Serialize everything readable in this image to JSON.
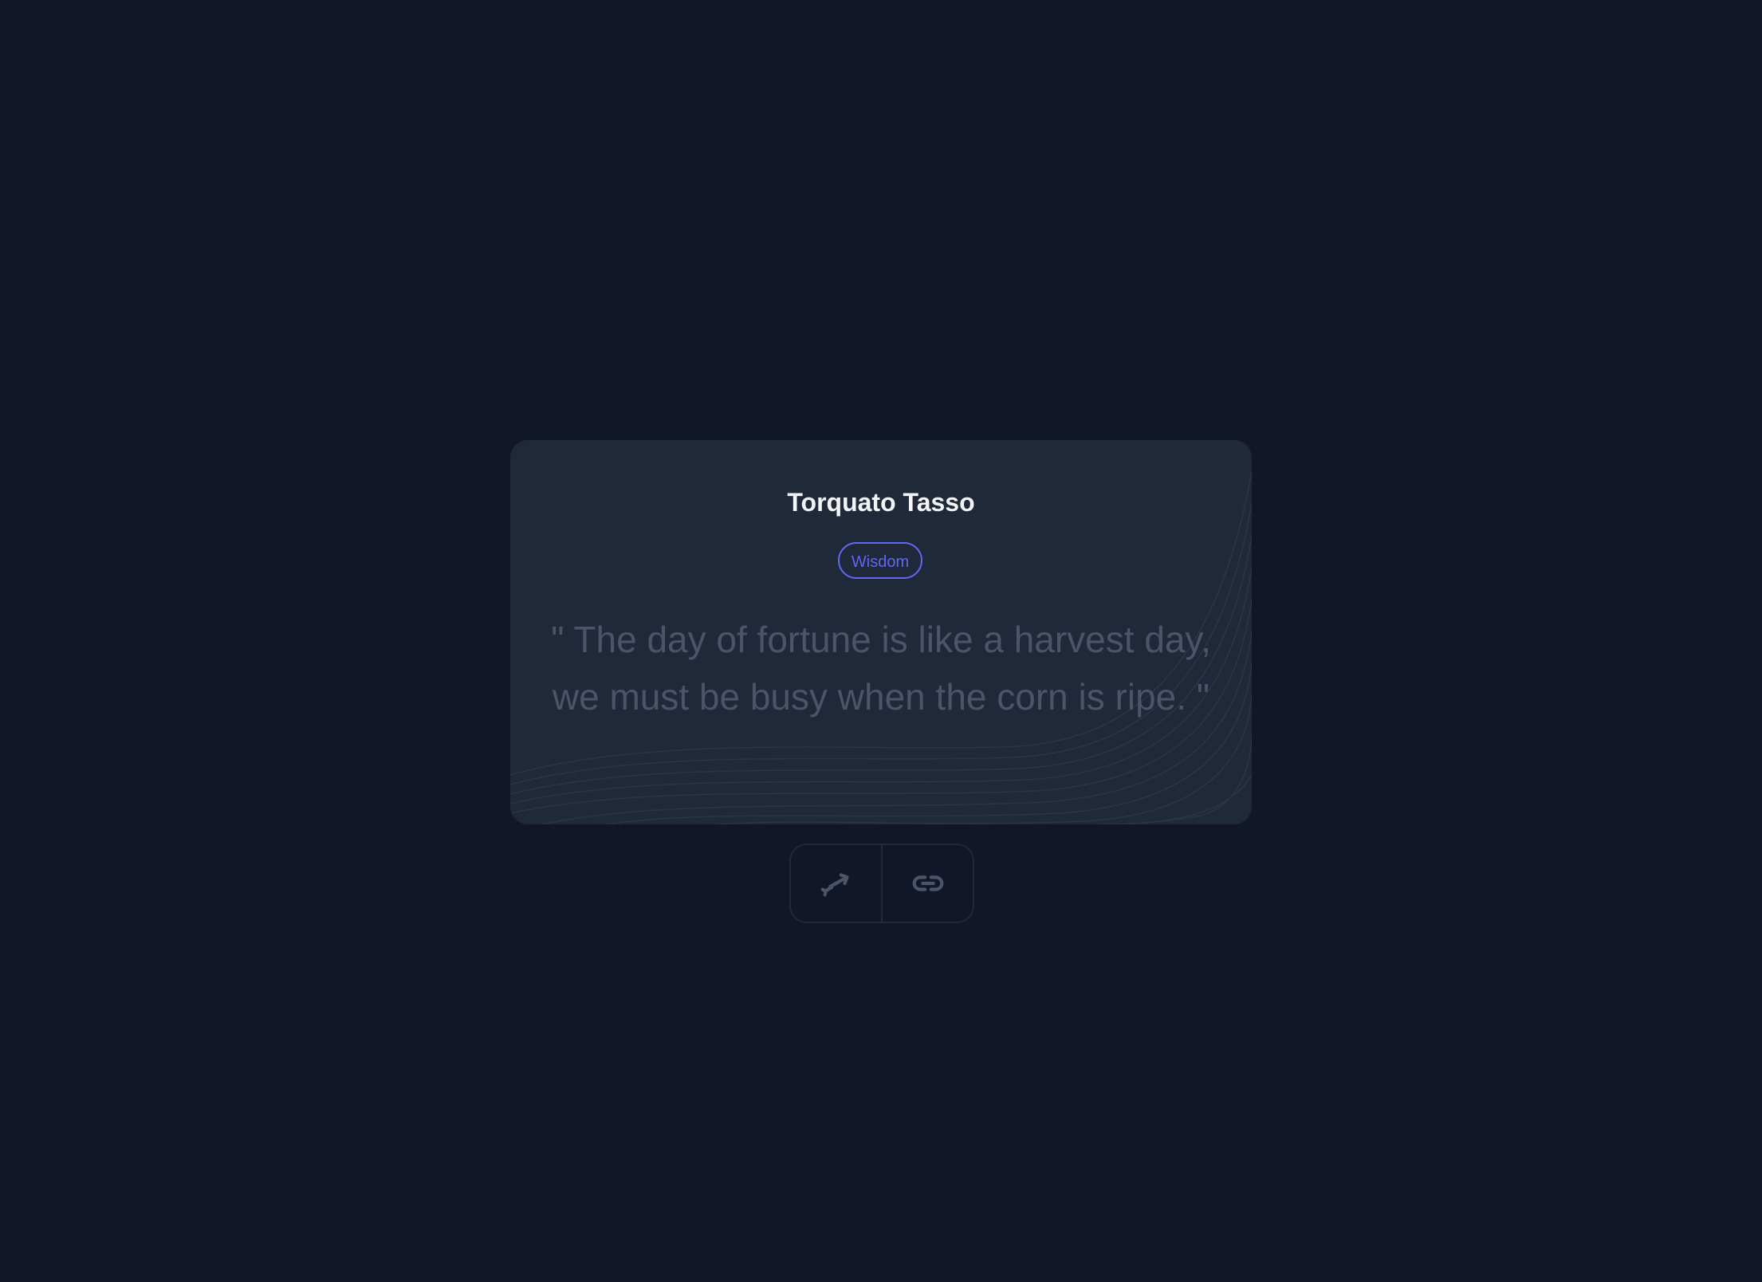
{
  "quote_card": {
    "author": "Torquato Tasso",
    "tag": "Wisdom",
    "quote_text": "\" The day of fortune is like a harvest day, we must be busy when the corn is ripe. \""
  },
  "actions": [
    {
      "icon": "swap-arrows-icon"
    },
    {
      "icon": "link-icon"
    }
  ],
  "colors": {
    "background": "#111729",
    "card": "#20293a",
    "accent": "#6366f1",
    "quote_text": "#4a5568",
    "author_text": "#f3f4f6"
  }
}
